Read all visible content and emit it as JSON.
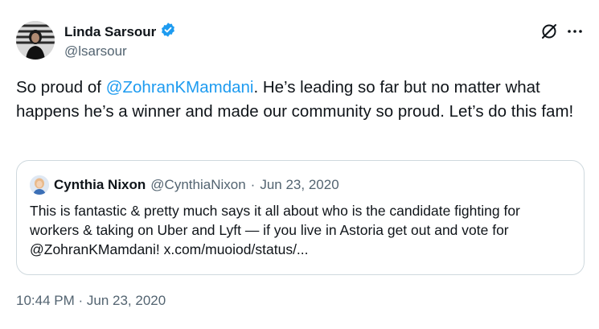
{
  "author": {
    "name": "Linda Sarsour",
    "handle": "@lsarsour"
  },
  "tweet": {
    "text_before": "So proud of ",
    "mention": "@ZohranKMamdani",
    "text_after": ". He’s leading so far but no matter what happens he’s a winner and made our community so proud. Let’s do this fam!"
  },
  "quote": {
    "name": "Cynthia Nixon",
    "handle": "@CynthiaNixon",
    "separator": "·",
    "date": "Jun 23, 2020",
    "text": "This is fantastic & pretty much says it all about who is the candidate fighting for workers & taking on Uber and Lyft — if you live in Astoria get out and vote for @ZohranKMamdani! x.com/muoiod/status/..."
  },
  "timestamp": "10:44 PM · Jun 23, 2020",
  "colors": {
    "verified_badge": "#1d9bf0",
    "link": "#1d9bf0",
    "secondary_text": "#536471"
  },
  "icons": [
    "verified-badge-icon",
    "grok-icon",
    "more-icon"
  ]
}
